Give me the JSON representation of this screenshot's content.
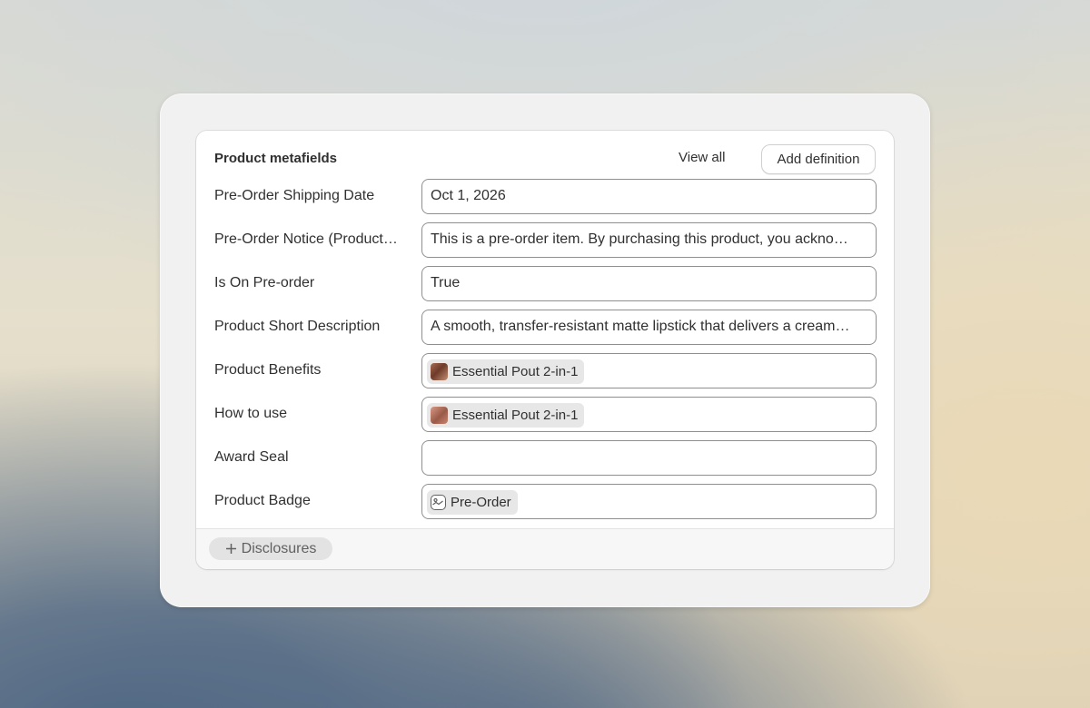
{
  "card": {
    "title": "Product metafields",
    "view_all_label": "View all",
    "add_definition_label": "Add definition"
  },
  "rows": [
    {
      "label": "Pre-Order Shipping Date",
      "value": "Oct 1, 2026"
    },
    {
      "label": "Pre-Order Notice (Product…",
      "value": "This is a pre-order item. By purchasing this product, you ackno…"
    },
    {
      "label": "Is On Pre-order",
      "value": "True"
    },
    {
      "label": "Product Short Description",
      "value": "A smooth, transfer-resistant matte lipstick that delivers a cream…"
    },
    {
      "label": "Product Benefits",
      "chip": "Essential Pout 2-in-1",
      "icon": "product-thumbnail"
    },
    {
      "label": "How to use",
      "chip": "Essential Pout 2-in-1",
      "icon": "product-thumbnail"
    },
    {
      "label": "Award Seal",
      "value": ""
    },
    {
      "label": "Product Badge",
      "chip": "Pre-Order",
      "icon": "image-icon"
    }
  ],
  "footer": {
    "disclosures_label": "Disclosures",
    "disclosures_icon": "plus-icon"
  }
}
